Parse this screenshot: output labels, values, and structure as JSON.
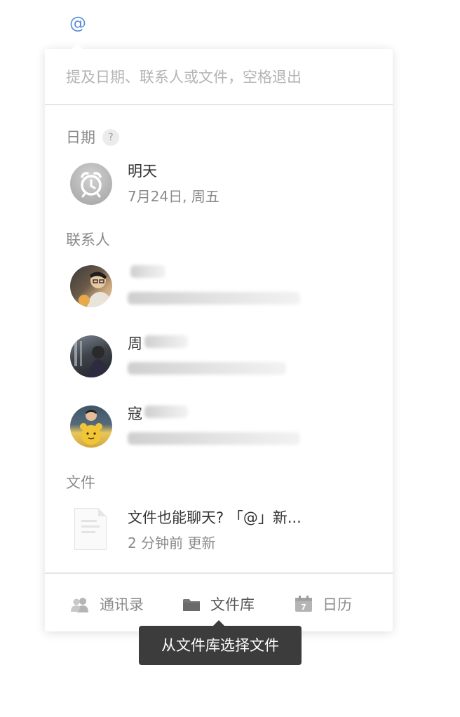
{
  "trigger": {
    "symbol": "@"
  },
  "search": {
    "placeholder": "提及日期、联系人或文件，空格退出"
  },
  "sections": {
    "date": {
      "heading": "日期",
      "help_icon": "?",
      "item": {
        "icon": "alarm-clock-icon",
        "title": "明天",
        "subtitle": "7月24日, 周五"
      }
    },
    "contacts": {
      "heading": "联系人",
      "items": [
        {
          "name": "",
          "email": "",
          "avatar": "avatar-photo"
        },
        {
          "name": "周",
          "email": "",
          "avatar": "avatar-photo"
        },
        {
          "name": "寇",
          "email": "",
          "avatar": "avatar-photo"
        }
      ]
    },
    "files": {
      "heading": "文件",
      "item": {
        "icon": "document-icon",
        "title": "文件也能聊天? 「@」新...",
        "subtitle": "2 分钟前 更新"
      }
    }
  },
  "footer": {
    "tabs": [
      {
        "label": "通讯录",
        "icon": "contacts-icon",
        "active": false
      },
      {
        "label": "文件库",
        "icon": "folder-icon",
        "active": true
      },
      {
        "label": "日历",
        "icon": "calendar-icon",
        "active": false
      }
    ],
    "calendar_icon_day": "7"
  },
  "tooltip": {
    "text": "从文件库选择文件"
  },
  "colors": {
    "accent": "#5b8fd6",
    "muted_text": "#8a8a8a",
    "tooltip_bg": "#3c3c3c"
  }
}
